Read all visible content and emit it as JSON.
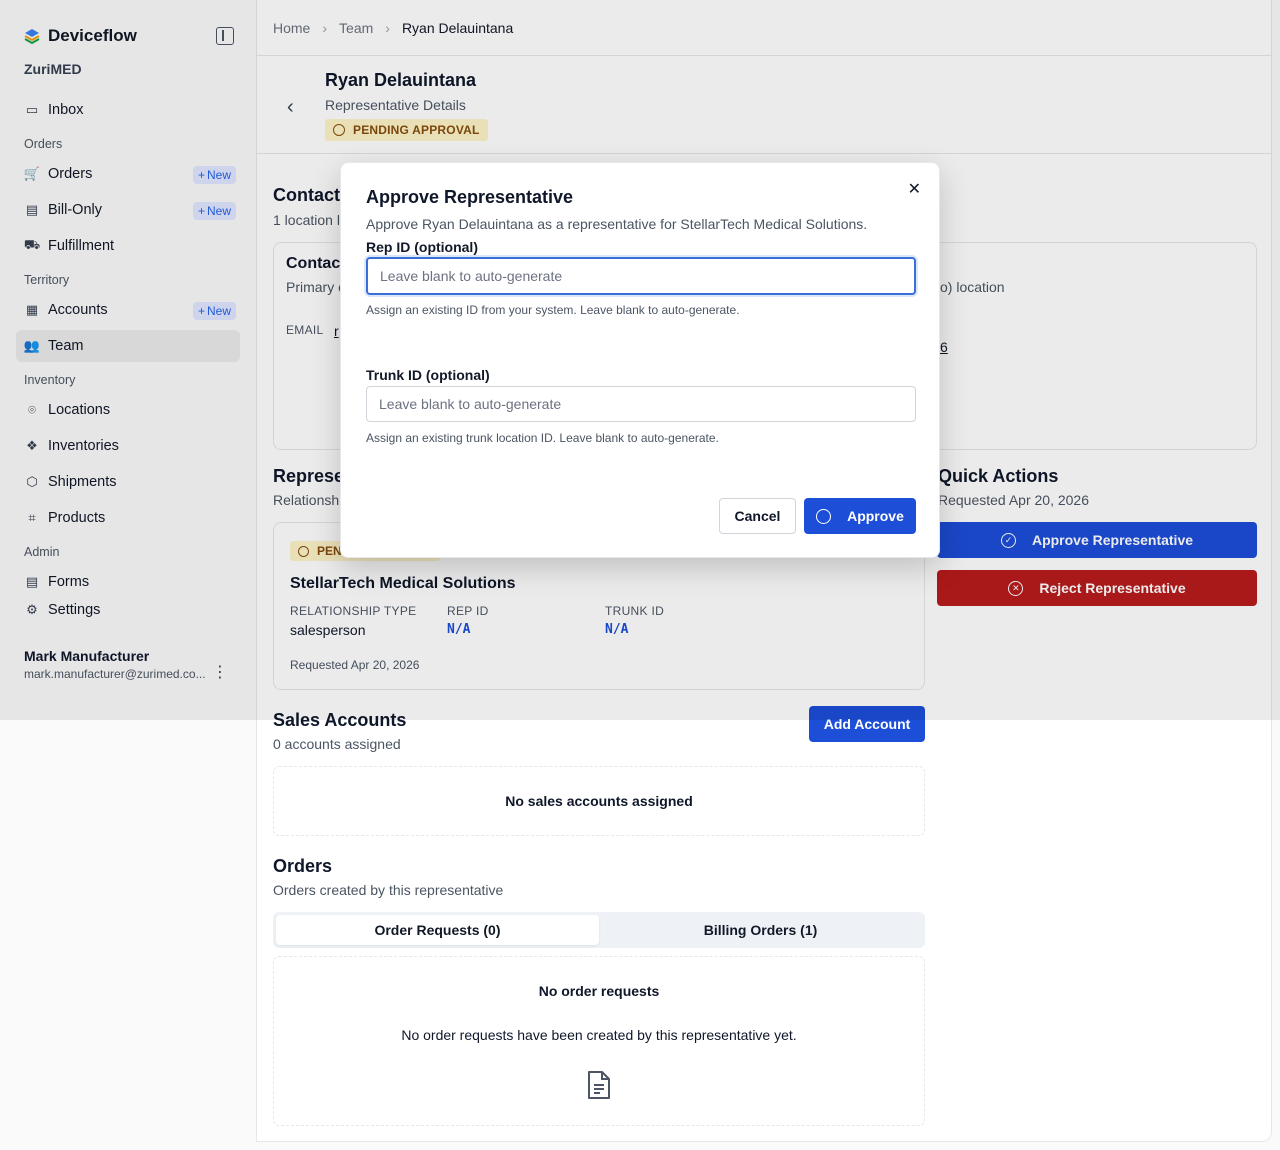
{
  "app": {
    "name": "Deviceflow",
    "org": "ZuriMED"
  },
  "sidebar": {
    "items": [
      {
        "type": "item",
        "label": "Inbox",
        "icon": "inbox-icon"
      },
      {
        "type": "group",
        "label": "Orders"
      },
      {
        "type": "item",
        "label": "Orders",
        "icon": "cart-icon",
        "badge": "New"
      },
      {
        "type": "item",
        "label": "Bill-Only",
        "icon": "bill-icon",
        "badge": "New"
      },
      {
        "type": "item",
        "label": "Fulfillment",
        "icon": "truck-icon"
      },
      {
        "type": "group",
        "label": "Territory"
      },
      {
        "type": "item",
        "label": "Accounts",
        "icon": "building-icon",
        "badge": "New"
      },
      {
        "type": "item",
        "label": "Team",
        "icon": "users-icon",
        "active": true
      },
      {
        "type": "group",
        "label": "Inventory"
      },
      {
        "type": "item",
        "label": "Locations",
        "icon": "map-pin-icon"
      },
      {
        "type": "item",
        "label": "Inventories",
        "icon": "boxes-icon"
      },
      {
        "type": "item",
        "label": "Shipments",
        "icon": "package-icon"
      },
      {
        "type": "item",
        "label": "Products",
        "icon": "tag-icon"
      },
      {
        "type": "group",
        "label": "Admin"
      },
      {
        "type": "item",
        "label": "Forms",
        "icon": "form-icon"
      },
      {
        "type": "item",
        "label": "Settings",
        "icon": "gear-icon"
      }
    ],
    "new_badge": "New",
    "user": {
      "name": "Mark Manufacturer",
      "email": "mark.manufacturer@zurimed.co..."
    }
  },
  "breadcrumb": {
    "home": "Home",
    "team": "Team",
    "current": "Ryan Delauintana"
  },
  "header": {
    "title": "Ryan Delauintana",
    "subtitle": "Representative Details",
    "status": "PENDING APPROVAL"
  },
  "contact": {
    "title": "Contact",
    "sub": "1 location l",
    "card_title": "Contact",
    "card_sub": "Primary c",
    "email_label": "EMAIL",
    "email_value": "r",
    "right_frag": "o) location",
    "right_frag2": "6"
  },
  "relationship": {
    "title": "Represe",
    "sub": "Relationshi",
    "status": "PEN",
    "company": "StellarTech Medical Solutions",
    "type_label": "RELATIONSHIP TYPE",
    "type_value": "salesperson",
    "rep_label": "REP ID",
    "rep_value": "N/A",
    "trunk_label": "TRUNK ID",
    "trunk_value": "N/A",
    "requested": "Requested Apr 20, 2026"
  },
  "quick_actions": {
    "title": "Quick Actions",
    "sub": "Requested Apr 20, 2026",
    "approve": "Approve Representative",
    "reject": "Reject Representative",
    "approve_color": "#1d4ed8",
    "reject_color": "#b91c1c"
  },
  "sales_accounts": {
    "title": "Sales Accounts",
    "sub": "0 accounts assigned",
    "add": "Add Account",
    "empty": "No sales accounts assigned"
  },
  "orders": {
    "title": "Orders",
    "sub": "Orders created by this representative",
    "tabs": [
      "Order Requests (0)",
      "Billing Orders (1)"
    ],
    "empty_title": "No order requests",
    "empty_desc": "No order requests have been created by this representative yet."
  },
  "modal": {
    "title": "Approve Representative",
    "desc": "Approve Ryan Delauintana as a representative for StellarTech Medical Solutions.",
    "rep_label": "Rep ID (optional)",
    "rep_placeholder": "Leave blank to auto-generate",
    "rep_help": "Assign an existing ID from your system. Leave blank to auto-generate.",
    "trunk_label": "Trunk ID (optional)",
    "trunk_placeholder": "Leave blank to auto-generate",
    "trunk_help": "Assign an existing trunk location ID. Leave blank to auto-generate.",
    "cancel": "Cancel",
    "approve": "Approve"
  }
}
